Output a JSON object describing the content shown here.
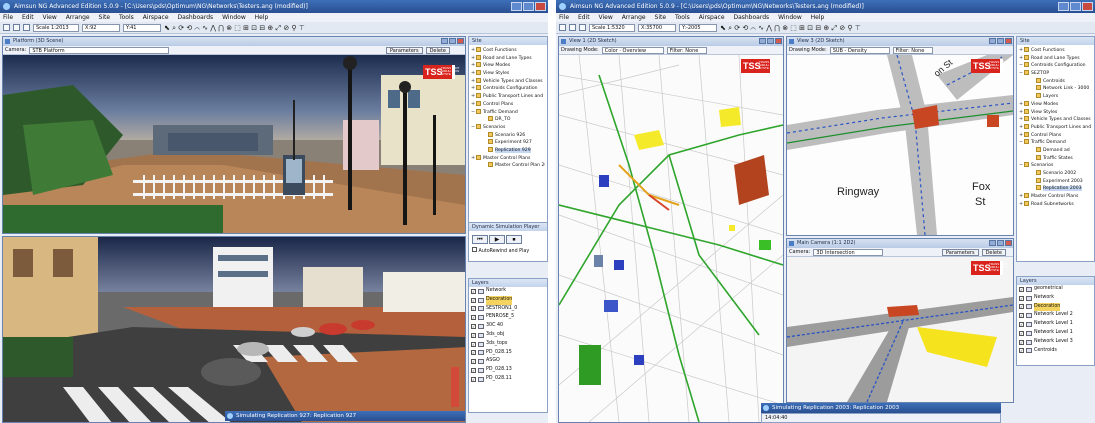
{
  "left_window": {
    "title": "Aimsun NG Advanced Edition 5.0.9 - [C:\\Users\\pds\\Optimum\\NG\\Networks\\Testers.ang (modified)]",
    "menu": [
      "File",
      "Edit",
      "View",
      "Arrange",
      "Site",
      "Tools",
      "Airspace",
      "Dashboards",
      "Window",
      "Help"
    ],
    "toolbar": {
      "scale": "Scale 1:2013",
      "field2": "X:92",
      "field3": "Y:41",
      "symbols": "⬉ ⌕ ⟳ ⟲ ⌒ ∿ ⋀ ⋂ ⊗ ⬚ ⊞ ⊡ ⊟ ⊕ ⤢ ⊘ ⚲ ⊤"
    },
    "view_top": {
      "title": "Platform (3D Scene)",
      "camera_label": "Camera:",
      "camera_value": "STB Platform",
      "params_button": "Parameters",
      "delete_button": "Delete"
    },
    "view_bottom": {
      "title": "3D View"
    },
    "site_panel": {
      "header": "Site",
      "items": [
        {
          "label": "Cost Functions",
          "exp": "+"
        },
        {
          "label": "Road and Lane Types",
          "exp": "+"
        },
        {
          "label": "View Modes",
          "exp": "+"
        },
        {
          "label": "View Styles",
          "exp": "+"
        },
        {
          "label": "Vehicle Types and Classes",
          "exp": "+"
        },
        {
          "label": "Centroids Configuration",
          "exp": "+"
        },
        {
          "label": "Public Transport Lines and Pla",
          "exp": "+"
        },
        {
          "label": "Control Plans",
          "exp": "+"
        },
        {
          "label": "Traffic Demand",
          "exp": "−"
        },
        {
          "label": "DR_TO",
          "exp": ""
        },
        {
          "label": "Scenarios",
          "exp": "−"
        },
        {
          "label": "Scenario 926",
          "exp": ""
        },
        {
          "label": "Experiment 927",
          "exp": ""
        },
        {
          "label": "Replication 929",
          "exp": "",
          "selected": true
        },
        {
          "label": "Master Control Plans",
          "exp": "+"
        },
        {
          "label": "Master Control Plan 201",
          "exp": ""
        }
      ]
    },
    "player_panel": {
      "header": "Dynamic Simulation Player",
      "rewind": "⏮",
      "play": "▶",
      "stop": "⏹",
      "checkbox_label": "AutoRewind and Play"
    },
    "layers_panel": {
      "header": "Layers",
      "rows": [
        {
          "name": "Network"
        },
        {
          "name": "Decoration",
          "selected": true
        },
        {
          "name": "SESTRON1_0"
        },
        {
          "name": "PENROSE_5"
        },
        {
          "name": "30C 40"
        },
        {
          "name": "3ds_obj"
        },
        {
          "name": "3ds_tops"
        },
        {
          "name": "PD_028.15"
        },
        {
          "name": "ASGO"
        },
        {
          "name": "PD_028.13"
        },
        {
          "name": "PD_028.11"
        }
      ]
    },
    "sim_dialog": {
      "title": "Simulating Replication 927: Replication 927"
    }
  },
  "right_window": {
    "title": "Aimsun NG Advanced Edition 5.0.9 - [C:\\Users\\pds\\Optimum\\NG\\Networks\\Testers.ang (modified)]",
    "menu": [
      "File",
      "Edit",
      "View",
      "Arrange",
      "Site",
      "Tools",
      "Airspace",
      "Dashboards",
      "Window",
      "Help"
    ],
    "toolbar": {
      "scale": "Scale 1:5320",
      "field2": "X:35700",
      "field3": "Y:-2005",
      "symbols": "⬉ ⌕ ⟳ ⟲ ⌒ ∿ ⋀ ⋂ ⊗ ⬚ ⊞ ⊡ ⊟ ⊕ ⤢ ⊘ ⚲ ⊤"
    },
    "view_map": {
      "title": "View 1 (2D Sketch)",
      "mode_label": "Drawing Mode:",
      "mode_value": "Color · Overview",
      "filter": "Filter: None"
    },
    "view_zoom": {
      "title": "View 3 (2D Sketch)",
      "mode_label": "Drawing Mode:",
      "mode_value": "SUB - Density",
      "filter": "Filter: None",
      "labels": [
        "Ringway",
        "Fox",
        "St",
        "on St"
      ]
    },
    "view_camera": {
      "title": "Main Camera (1:1 2D2)",
      "camera_label": "Camera:",
      "camera_value": "3D Intersection",
      "params_button": "Parameters",
      "delete_button": "Delete"
    },
    "site_panel": {
      "header": "Site",
      "items": [
        {
          "label": "Cost Functions",
          "exp": "+"
        },
        {
          "label": "Road and Lane Types",
          "exp": "+"
        },
        {
          "label": "Centroids Configuration",
          "exp": "−"
        },
        {
          "label": "SEZTOP",
          "exp": "−"
        },
        {
          "label": "Centroids",
          "exp": ""
        },
        {
          "label": "Network Link - 3000",
          "exp": ""
        },
        {
          "label": "Layers",
          "exp": ""
        },
        {
          "label": "View Modes",
          "exp": "+"
        },
        {
          "label": "View Styles",
          "exp": "+"
        },
        {
          "label": "Vehicle Types and Classes",
          "exp": "+"
        },
        {
          "label": "Public Transport Lines and Pla",
          "exp": "+"
        },
        {
          "label": "Control Plans",
          "exp": "+"
        },
        {
          "label": "Traffic Demand",
          "exp": "−"
        },
        {
          "label": "Demand ad",
          "exp": ""
        },
        {
          "label": "Traffic States",
          "exp": ""
        },
        {
          "label": "Scenarios",
          "exp": "−"
        },
        {
          "label": "Scenario 2002",
          "exp": ""
        },
        {
          "label": "Experiment 2003",
          "exp": ""
        },
        {
          "label": "Replication 2003",
          "exp": "",
          "selected": true
        },
        {
          "label": "Master Control Plans",
          "exp": "+"
        },
        {
          "label": "Road Subnetworks",
          "exp": "+"
        }
      ]
    },
    "layers_panel": {
      "header": "Layers",
      "rows": [
        {
          "name": "geometrical"
        },
        {
          "name": "Network"
        },
        {
          "name": "Decoration",
          "selected": true
        },
        {
          "name": "Network Level 2"
        },
        {
          "name": "Network Level 1"
        },
        {
          "name": "Network Level 1"
        },
        {
          "name": "Network Level 3"
        },
        {
          "name": "Centroids"
        }
      ]
    },
    "sim_dialog": {
      "title": "Simulating Replication 2003: Replication 2003",
      "time": "14:04:40"
    }
  },
  "branding": {
    "logo_text": "TSS",
    "logo_color": "#d9231d"
  }
}
